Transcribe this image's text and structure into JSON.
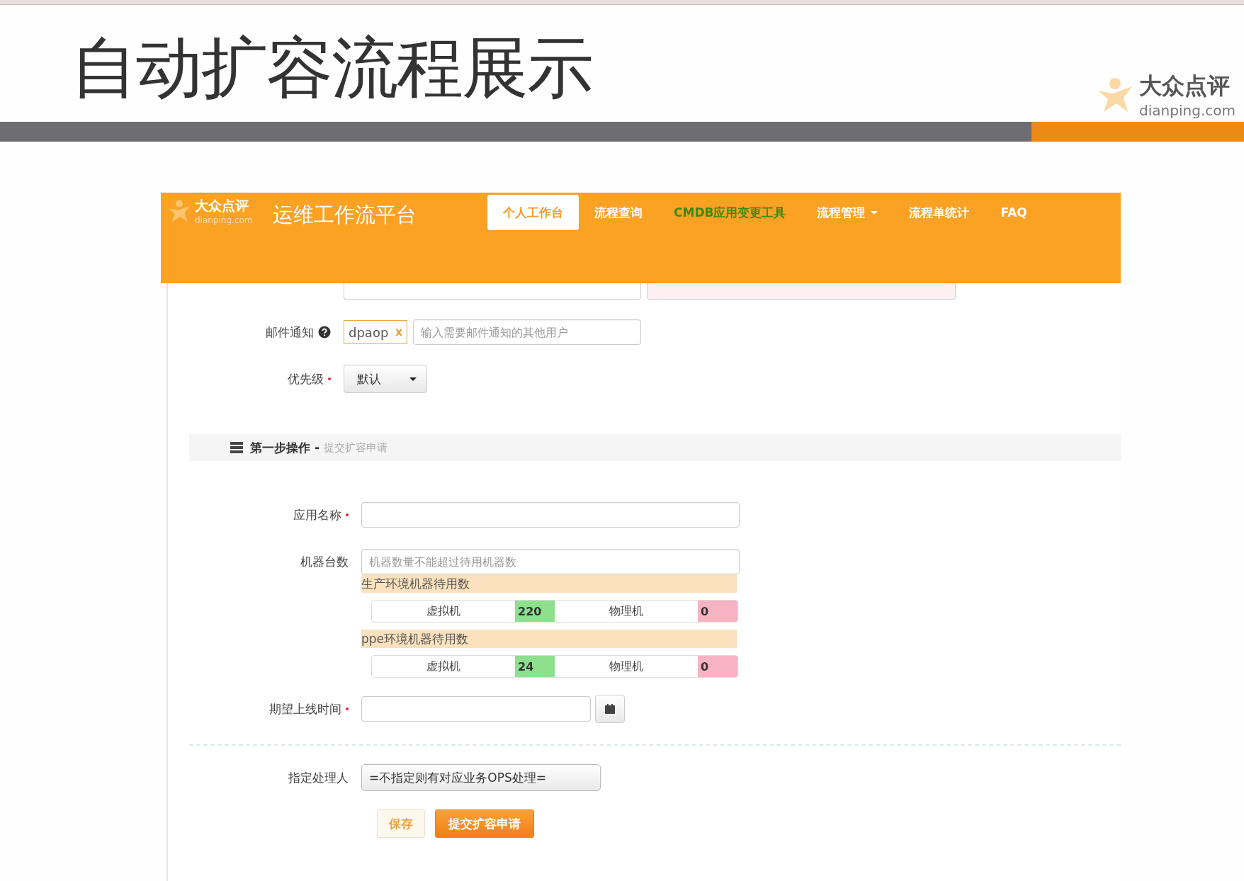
{
  "slide": {
    "title": "自动扩容流程展示",
    "logo": {
      "name": "大众点评",
      "domain": "dianping.com"
    }
  },
  "app": {
    "logo": {
      "name": "大众点评",
      "domain": "dianping.com"
    },
    "title": "运维工作流平台",
    "nav": [
      {
        "label": "个人工作台",
        "selected": true,
        "kind": "link"
      },
      {
        "label": "流程查询",
        "selected": false,
        "kind": "link"
      },
      {
        "label": "CMDB应用变更工具",
        "selected": false,
        "kind": "accent"
      },
      {
        "label": "流程管理",
        "selected": false,
        "kind": "dropdown"
      },
      {
        "label": "流程单统计",
        "selected": false,
        "kind": "link"
      },
      {
        "label": "FAQ",
        "selected": false,
        "kind": "link"
      }
    ]
  },
  "form": {
    "mail": {
      "label": "邮件通知",
      "tag": "dpaop",
      "tag_remove": "x",
      "placeholder": "输入需要邮件通知的其他用户"
    },
    "priority": {
      "label": "优先级",
      "required": true,
      "value": "默认"
    },
    "section": {
      "title": "第一步操作 -",
      "subtitle": "提交扩容申请"
    },
    "app_name": {
      "label": "应用名称",
      "required": true
    },
    "machine_count": {
      "label": "机器台数",
      "required": false,
      "placeholder": "机器数量不能超过待用机器数",
      "pools": [
        {
          "title": "生产环境机器待用数",
          "cells": [
            {
              "name": "虚拟机",
              "count": "220",
              "color": "#8ee08e"
            },
            {
              "name": "物理机",
              "count": "0",
              "color": "#f7b3c2"
            }
          ]
        },
        {
          "title": "ppe环境机器待用数",
          "cells": [
            {
              "name": "虚拟机",
              "count": "24",
              "color": "#8ee08e"
            },
            {
              "name": "物理机",
              "count": "0",
              "color": "#f7b3c2"
            }
          ]
        }
      ]
    },
    "launch_time": {
      "label": "期望上线时间",
      "required": true
    },
    "assignee": {
      "label": "指定处理人",
      "required": false,
      "value": "=不指定则有对应业务OPS处理="
    },
    "buttons": [
      {
        "label": "保存",
        "kind": "secondary"
      },
      {
        "label": "提交扩容申请",
        "kind": "primary"
      }
    ]
  }
}
